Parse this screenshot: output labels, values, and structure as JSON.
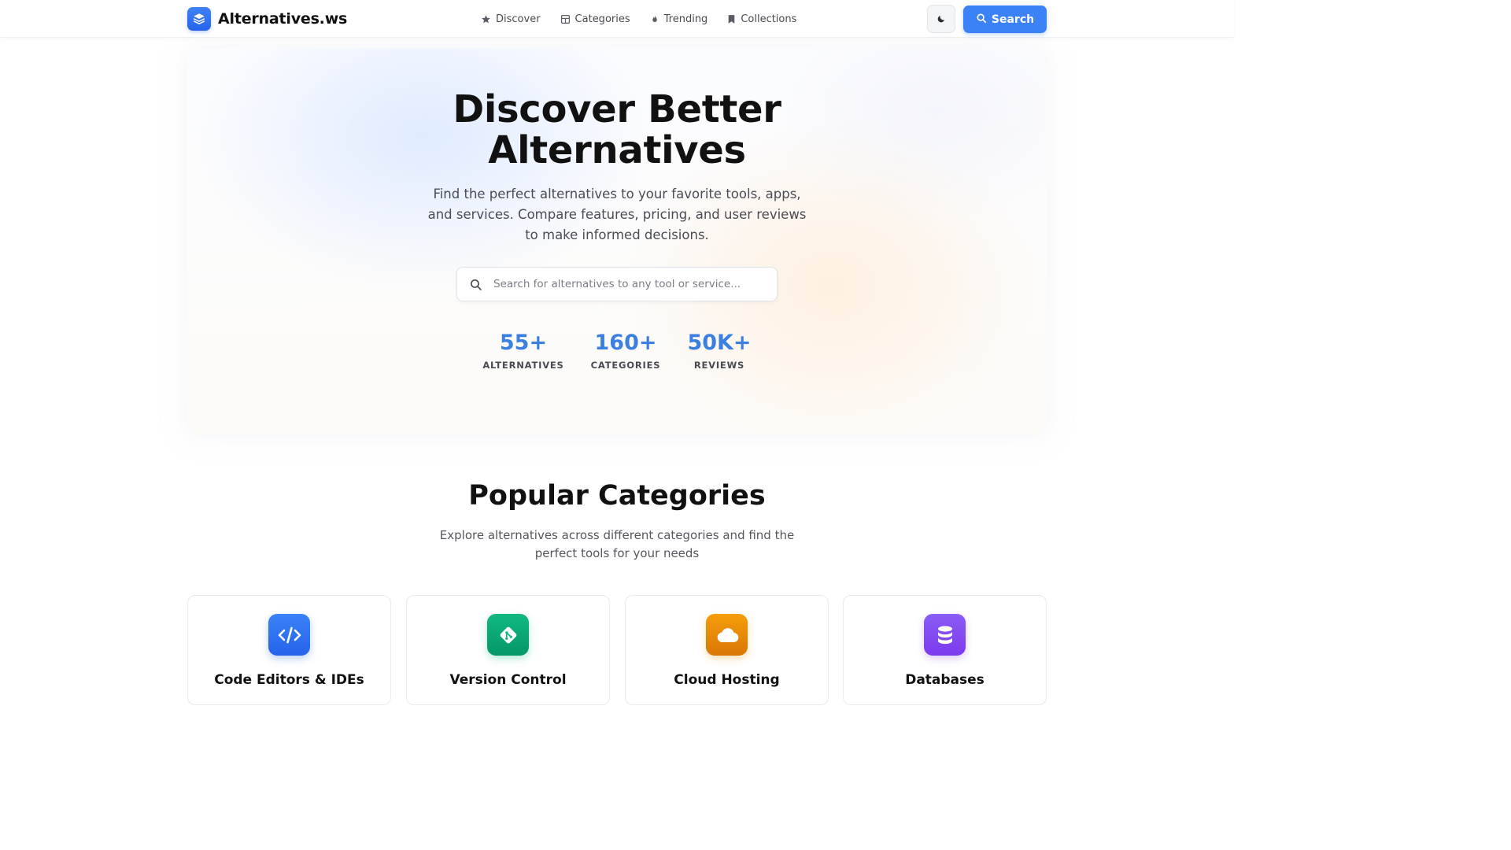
{
  "header": {
    "brand": "Alternatives.ws",
    "nav": [
      {
        "label": "Discover",
        "icon": "star-icon"
      },
      {
        "label": "Categories",
        "icon": "grid-icon"
      },
      {
        "label": "Trending",
        "icon": "flame-icon"
      },
      {
        "label": "Collections",
        "icon": "bookmark-icon"
      }
    ],
    "theme_toggle_icon": "moon-icon",
    "search_label": "Search"
  },
  "hero": {
    "title_line1": "Discover Better",
    "title_line2": "Alternatives",
    "subtitle": "Find the perfect alternatives to your favorite tools, apps, and services. Compare features, pricing, and user reviews to make informed decisions.",
    "search_placeholder": "Search for alternatives to any tool or service...",
    "stats": [
      {
        "value": "55+",
        "label": "ALTERNATIVES"
      },
      {
        "value": "160+",
        "label": "CATEGORIES"
      },
      {
        "value": "50K+",
        "label": "REVIEWS"
      }
    ]
  },
  "categories": {
    "title": "Popular Categories",
    "subtitle": "Explore alternatives across different categories and find the perfect tools for your needs",
    "items": [
      {
        "name": "Code Editors & IDEs",
        "icon": "code-icon",
        "color": "#3b82f6"
      },
      {
        "name": "Version Control",
        "icon": "git-icon",
        "color": "#10b981"
      },
      {
        "name": "Cloud Hosting",
        "icon": "cloud-icon",
        "color": "#f59e0b"
      },
      {
        "name": "Databases",
        "icon": "database-icon",
        "color": "#8b5cf6"
      }
    ]
  },
  "colors": {
    "primary": "#3b82f6",
    "stat_value": "#3b7fe0",
    "text": "#111111"
  }
}
